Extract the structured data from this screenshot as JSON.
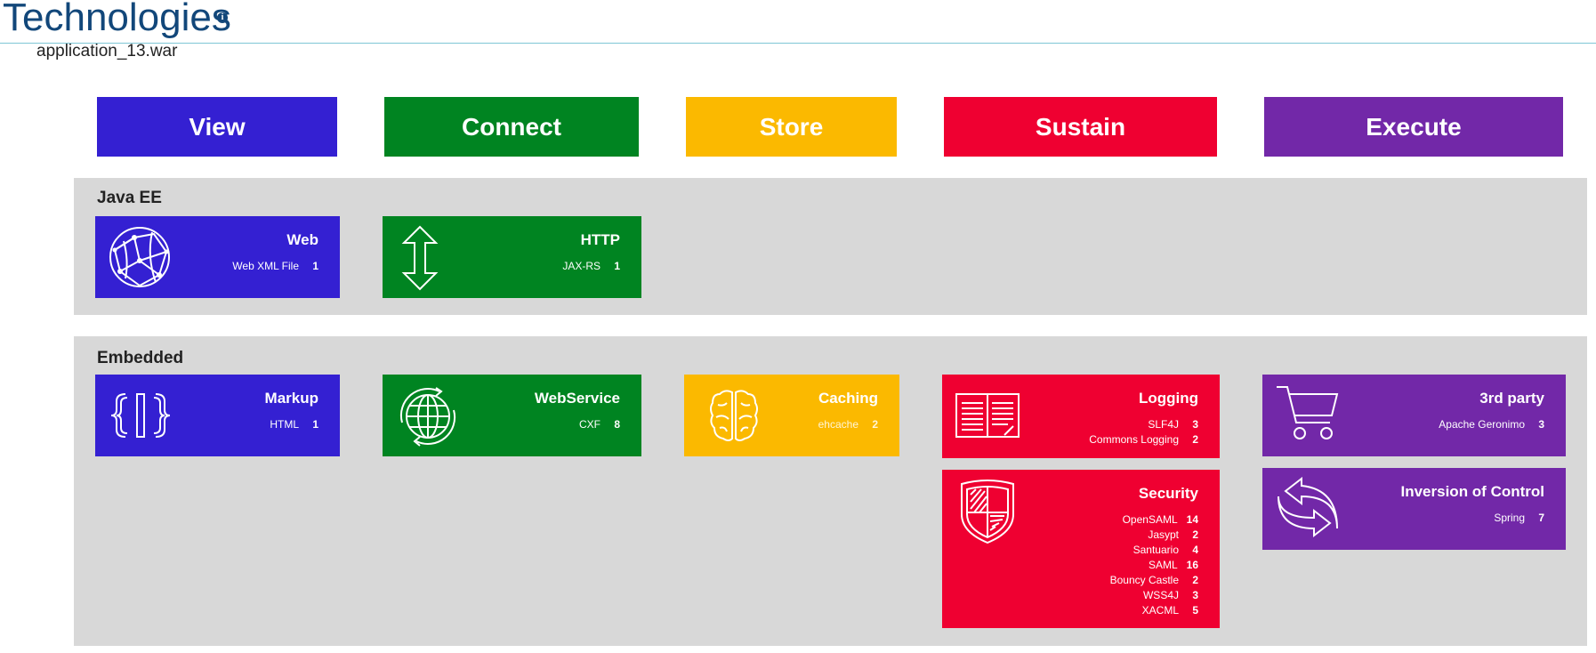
{
  "header": {
    "title": "Technologies",
    "info_icon": "info-icon",
    "subtitle": "application_13.war"
  },
  "colors": {
    "view": "#3420d2",
    "connect": "#008421",
    "store": "#fbb900",
    "sustain": "#ef0031",
    "execute": "#7228a8",
    "title": "#12477a"
  },
  "columns": [
    "View",
    "Connect",
    "Store",
    "Sustain",
    "Execute"
  ],
  "sections": {
    "javaee": {
      "label": "Java EE",
      "web": {
        "title": "Web",
        "icon": "globe-network-icon",
        "rows": [
          {
            "name": "Web XML File",
            "count": "1"
          }
        ]
      },
      "http": {
        "title": "HTTP",
        "icon": "up-down-arrow-icon",
        "rows": [
          {
            "name": "JAX-RS",
            "count": "1"
          }
        ]
      }
    },
    "embedded": {
      "label": "Embedded",
      "markup": {
        "title": "Markup",
        "icon": "braces-icon",
        "rows": [
          {
            "name": "HTML",
            "count": "1"
          }
        ]
      },
      "webservice": {
        "title": "WebService",
        "icon": "globe-refresh-icon",
        "rows": [
          {
            "name": "CXF",
            "count": "8"
          }
        ]
      },
      "caching": {
        "title": "Caching",
        "icon": "brain-icon",
        "rows": [
          {
            "name": "ehcache",
            "count": "2"
          }
        ]
      },
      "logging": {
        "title": "Logging",
        "icon": "book-icon",
        "rows": [
          {
            "name": "SLF4J",
            "count": "3"
          },
          {
            "name": "Commons Logging",
            "count": "2"
          }
        ]
      },
      "security": {
        "title": "Security",
        "icon": "shield-icon",
        "rows": [
          {
            "name": "OpenSAML",
            "count": "14"
          },
          {
            "name": "Jasypt",
            "count": "2"
          },
          {
            "name": "Santuario",
            "count": "4"
          },
          {
            "name": "SAML",
            "count": "16"
          },
          {
            "name": "Bouncy Castle",
            "count": "2"
          },
          {
            "name": "WSS4J",
            "count": "3"
          },
          {
            "name": "XACML",
            "count": "5"
          }
        ]
      },
      "thirdparty": {
        "title": "3rd party",
        "icon": "shopping-cart-icon",
        "rows": [
          {
            "name": "Apache Geronimo",
            "count": "3"
          }
        ]
      },
      "ioc": {
        "title": "Inversion of Control",
        "icon": "exchange-arrows-icon",
        "rows": [
          {
            "name": "Spring",
            "count": "7"
          }
        ]
      }
    }
  }
}
